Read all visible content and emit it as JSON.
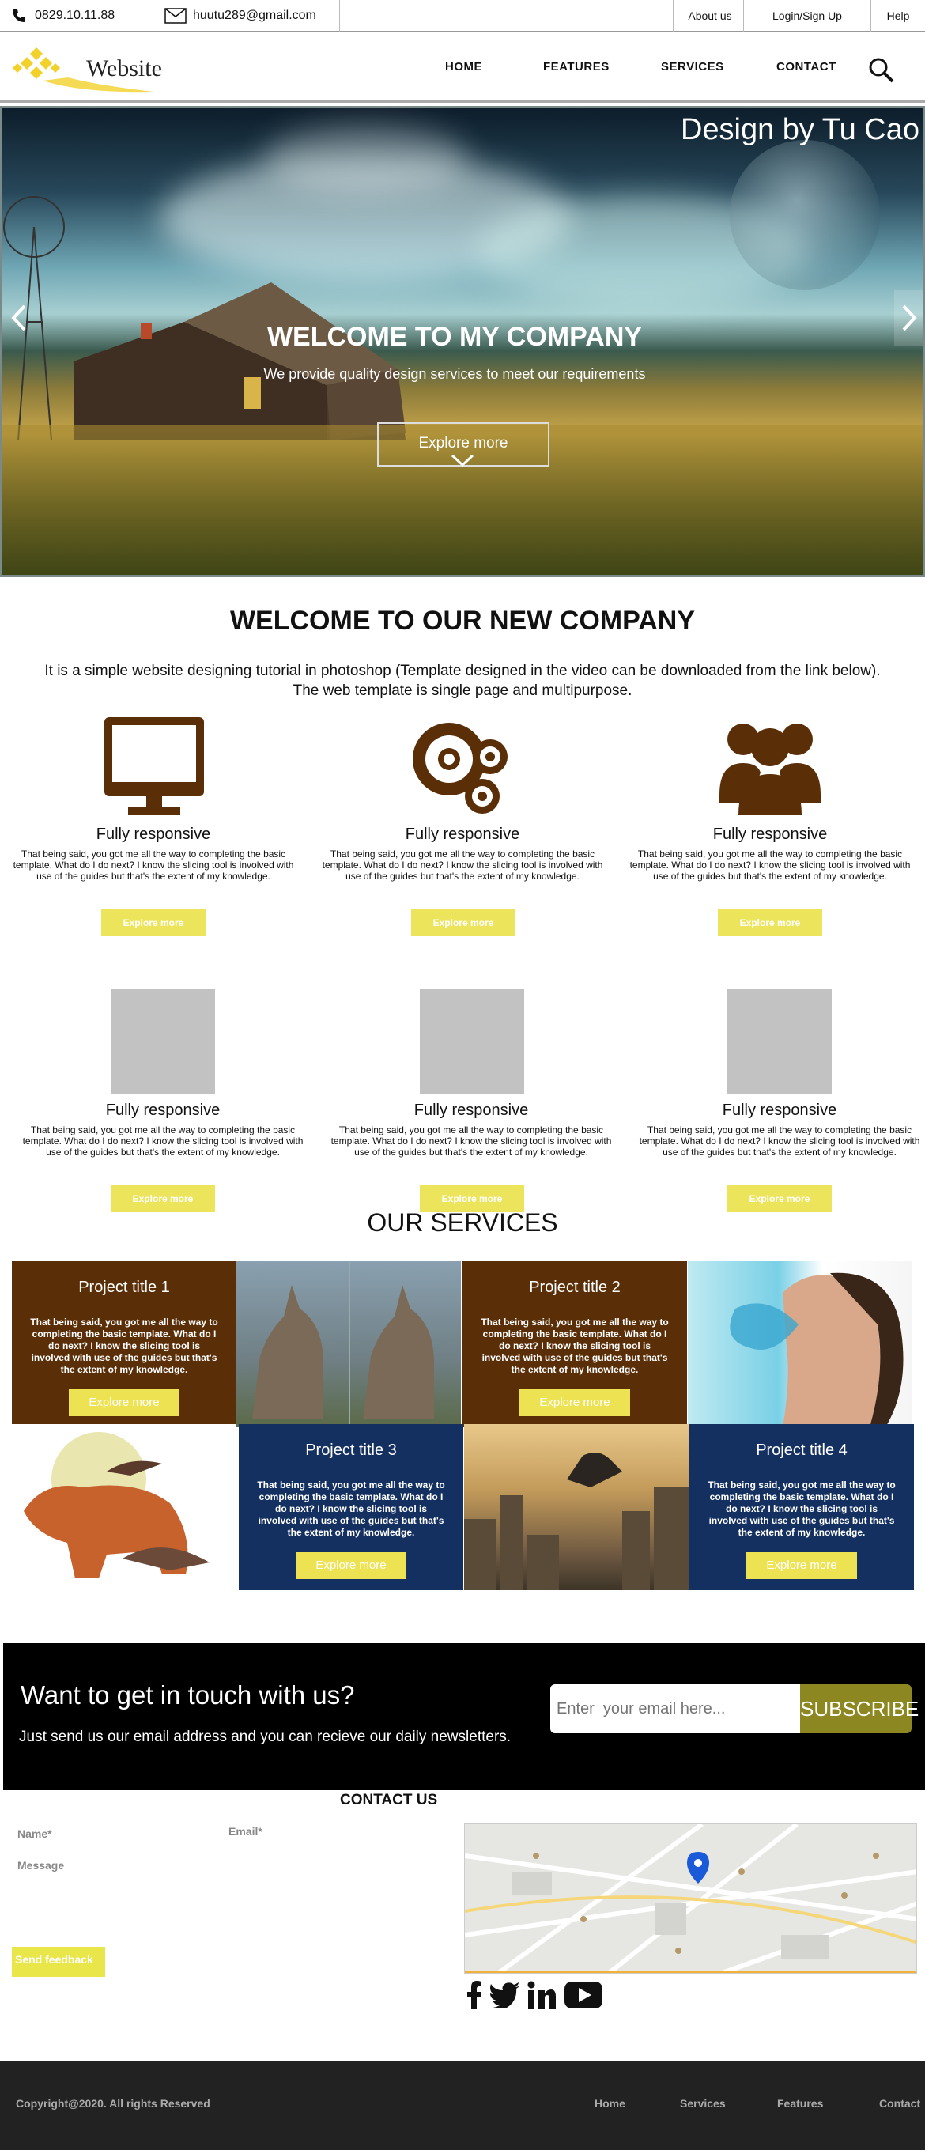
{
  "topbar": {
    "phone": "0829.10.11.88",
    "email": "huutu289@gmail.com",
    "links": [
      "About us",
      "Login/Sign Up",
      "Help"
    ]
  },
  "header": {
    "logo_text": "Website",
    "nav": [
      "HOME",
      "FEATURES",
      "SERVICES",
      "CONTACT"
    ]
  },
  "hero": {
    "credit": "Design by Tu Cao",
    "title": "WELCOME TO MY COMPANY",
    "subtitle": "We provide quality design services to meet our requirements",
    "button": "Explore more"
  },
  "welcome": {
    "title": "WELCOME TO OUR NEW COMPANY",
    "text_line1": "It is a simple website designing tutorial in photoshop (Template designed in the video can be downloaded from the link below).",
    "text_line2": "The web template is single page and multipurpose."
  },
  "features": [
    {
      "title": "Fully responsive",
      "desc": "That being said, you got me all the way to completing the basic template. What do I do next? I know the slicing tool is involved with use of the guides but that's the extent of my knowledge.",
      "button": "Explore more",
      "icon": "monitor-icon"
    },
    {
      "title": "Fully responsive",
      "desc": "That being said, you got me all the way to completing the basic template. What do I do next? I know the slicing tool is involved with use of the guides but that's the extent of my knowledge.",
      "button": "Explore more",
      "icon": "gears-icon"
    },
    {
      "title": "Fully responsive",
      "desc": "That being said, you got me all the way to completing the basic template. What do I do next? I know the slicing tool is involved with use of the guides but that's the extent of my knowledge.",
      "button": "Explore more",
      "icon": "users-icon"
    },
    {
      "title": "Fully responsive",
      "desc": "That being said, you got me all the way to completing the basic template. What do I do next? I know the slicing tool is involved with use of the guides but that's the extent of my knowledge.",
      "button": "Explore more",
      "icon": "placeholder"
    },
    {
      "title": "Fully responsive",
      "desc": "That being said, you got me all the way to completing the basic template. What do I do next? I know the slicing tool is involved with use of the guides but that's the extent of my knowledge.",
      "button": "Explore more",
      "icon": "placeholder"
    },
    {
      "title": "Fully responsive",
      "desc": "That being said, you got me all the way to completing the basic template. What do I do next? I know the slicing tool is involved with use of the guides but that's the extent of my knowledge.",
      "button": "Explore more",
      "icon": "placeholder"
    }
  ],
  "services": {
    "title": "OUR SERVICES",
    "projects": [
      {
        "title": "Project title 1",
        "desc": "That being said, you got me all the way to completing the basic template. What do I do next? I know the slicing tool is involved with use of the guides but that's the extent of my knowledge.",
        "button": "Explore more"
      },
      {
        "title": "Project title 2",
        "desc": "That being said, you got me all the way to completing the basic template. What do I do next? I know the slicing tool is involved with use of the guides but that's the extent of my knowledge.",
        "button": "Explore more"
      },
      {
        "title": "Project title 3",
        "desc": "That being said, you got me all the way to completing the basic template. What do I do next? I know the slicing tool is involved with use of the guides but that's the extent of my knowledge.",
        "button": "Explore more"
      },
      {
        "title": "Project title 4",
        "desc": "That being said, you got me all the way to completing the basic template. What do I do next? I know the slicing tool is involved with use of the guides but that's the extent of my knowledge.",
        "button": "Explore more"
      }
    ]
  },
  "newsletter": {
    "title": "Want to get in touch with us?",
    "text": "Just send us our email address and you can recieve our daily newsletters.",
    "placeholder": "Enter  your email here...",
    "button": "SUBSCRIBE"
  },
  "contact": {
    "title": "CONTACT US",
    "name_label": "Name*",
    "email_label": "Email*",
    "message_label": "Message",
    "button": "Send feedback"
  },
  "footer": {
    "copyright": "Copyright@2020. All rights Reserved",
    "links": [
      "Home",
      "Services",
      "Features",
      "Contact"
    ]
  },
  "colors": {
    "accent_yellow": "#ece55b",
    "brown": "#5a2e07",
    "navy": "#143060",
    "footer_bg": "#222222"
  }
}
